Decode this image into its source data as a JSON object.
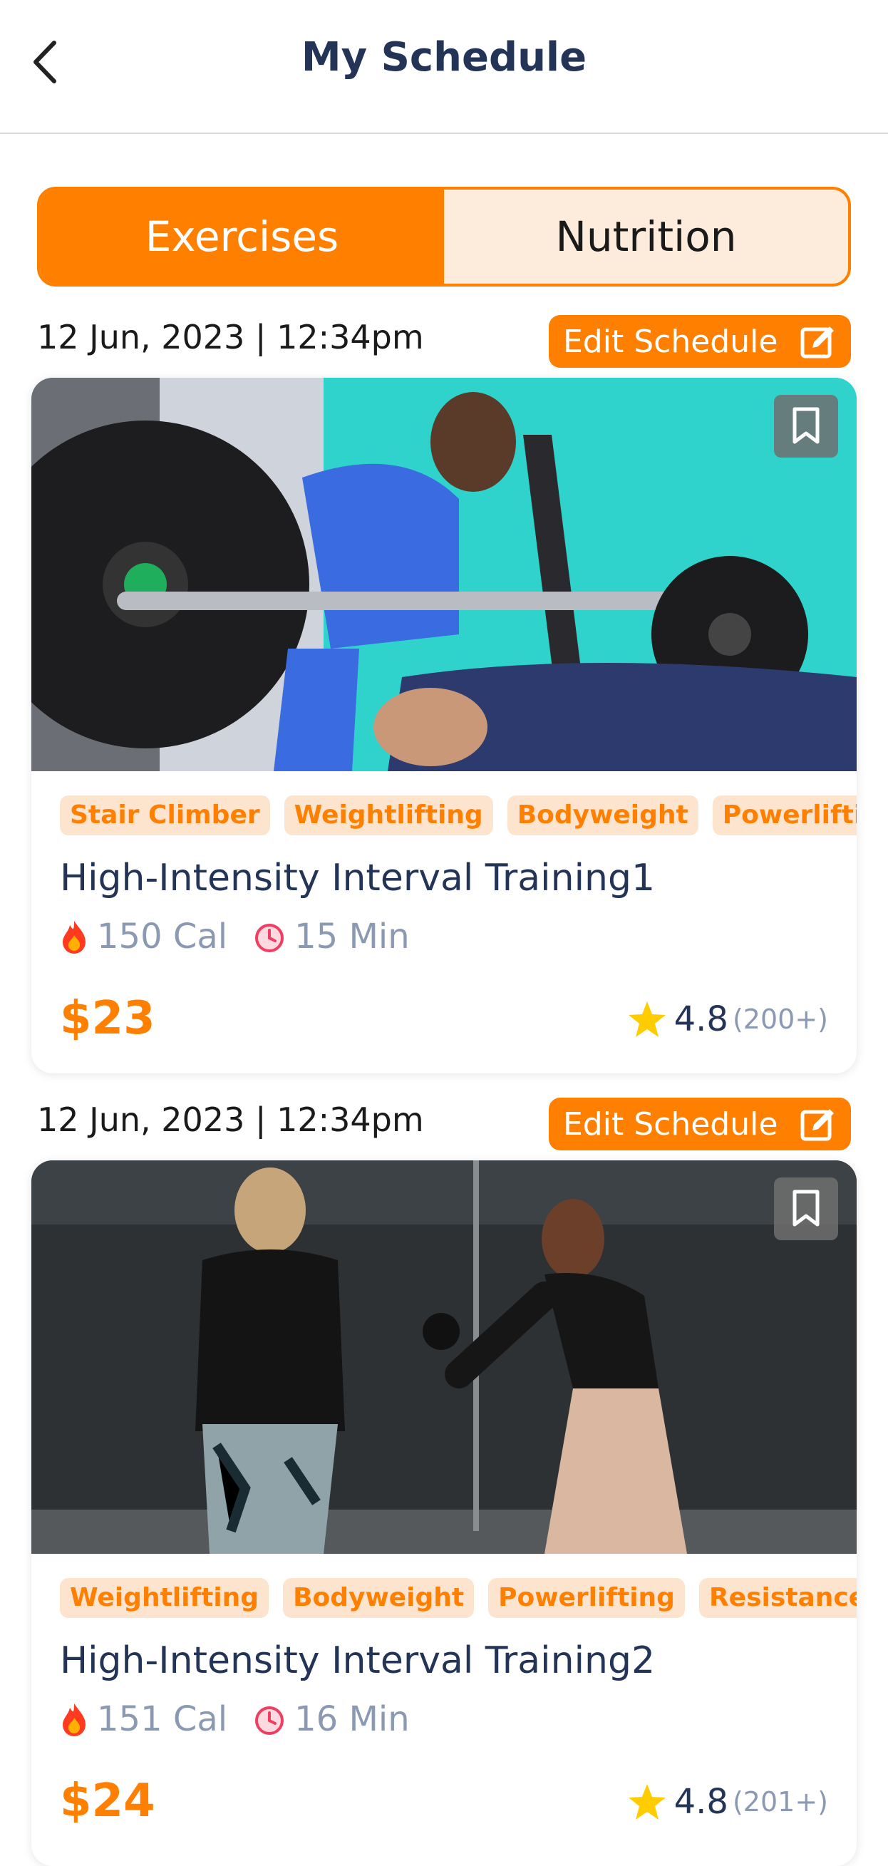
{
  "header": {
    "title": "My Schedule"
  },
  "tabs": [
    {
      "label": "Exercises",
      "active": true
    },
    {
      "label": "Nutrition",
      "active": false
    }
  ],
  "colors": {
    "accent": "#ff8000",
    "tag_bg": "#fde4cf",
    "tab_inactive_bg": "#fdebdb",
    "muted": "#8b99b3",
    "title": "#243457"
  },
  "schedules": [
    {
      "date": "12 Jun, 2023 | 12:34pm",
      "edit_label": "Edit Schedule",
      "tags": [
        "Stair Climber",
        "Weightlifting",
        "Bodyweight",
        "Powerlifting"
      ],
      "title": "High-Intensity Interval Training1",
      "calories": "150 Cal",
      "duration": "15 Min",
      "price": "$23",
      "rating": "4.8",
      "rating_count": "(200+)"
    },
    {
      "date": "12 Jun, 2023 | 12:34pm",
      "edit_label": "Edit Schedule",
      "tags": [
        "Weightlifting",
        "Bodyweight",
        "Powerlifting",
        "Resistance B"
      ],
      "title": "High-Intensity Interval Training2",
      "calories": "151 Cal",
      "duration": "16 Min",
      "price": "$24",
      "rating": "4.8",
      "rating_count": "(201+)"
    }
  ]
}
